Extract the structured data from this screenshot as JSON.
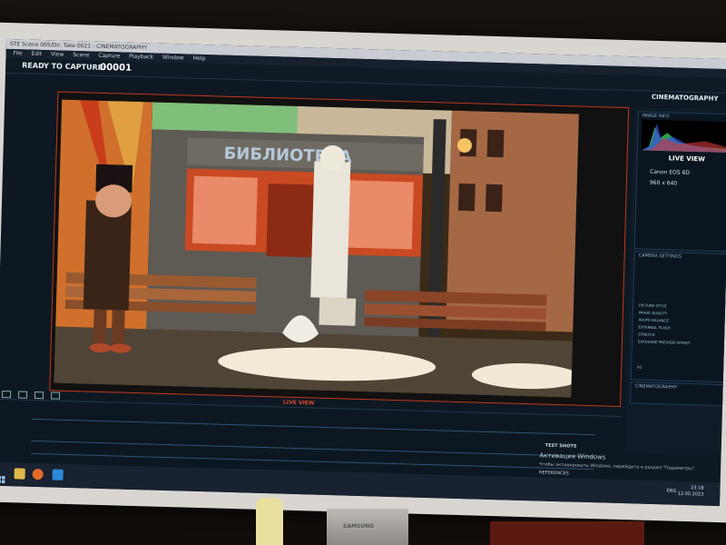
{
  "window": {
    "title": "STE Scene 005/Dir. Take 0021 - CINEMATOGRAPHY"
  },
  "menu": [
    "File",
    "Edit",
    "View",
    "Scene",
    "Capture",
    "Playback",
    "Window",
    "Help"
  ],
  "capture": {
    "status": "READY TO CAPTURE:",
    "frame": "00001"
  },
  "workspace": {
    "title": "CINEMATOGRAPHY"
  },
  "viewer": {
    "mode_label": "LIVE VIEW",
    "sign_text": "БИБЛИОТЕКА"
  },
  "panel": {
    "image_info_label": "IMAGE INFO",
    "live_view": "LIVE VIEW",
    "camera": "Canon EOS 6D",
    "resolution": "960 x 640",
    "camera_settings_label": "CAMERA SETTINGS",
    "settings": [
      "PICTURE STYLE",
      "IMAGE QUALITY",
      "WHITE BALANCE",
      "EXTERNAL FLASH",
      "STRETCH",
      "EXPOSURE PREVIEW OFFSET"
    ],
    "cinematography_label": "CINEMATOGRAPHY",
    "x1": "X1"
  },
  "bottom": {
    "test_shots": "TEST SHOTS",
    "references": "REFERENCES",
    "activate_title": "Активация Windows",
    "activate_sub": "Чтобы активировать Windows, перейдите в раздел \"Параметры\"."
  },
  "taskbar": {
    "lang": "ENG",
    "time": "23:18",
    "date": "12.05.2023"
  },
  "monitor_brand": "SAMSUNG",
  "colors": {
    "accent": "#c2391e",
    "panel": "#0f1b27",
    "live_view_text": "#d94a2c"
  }
}
